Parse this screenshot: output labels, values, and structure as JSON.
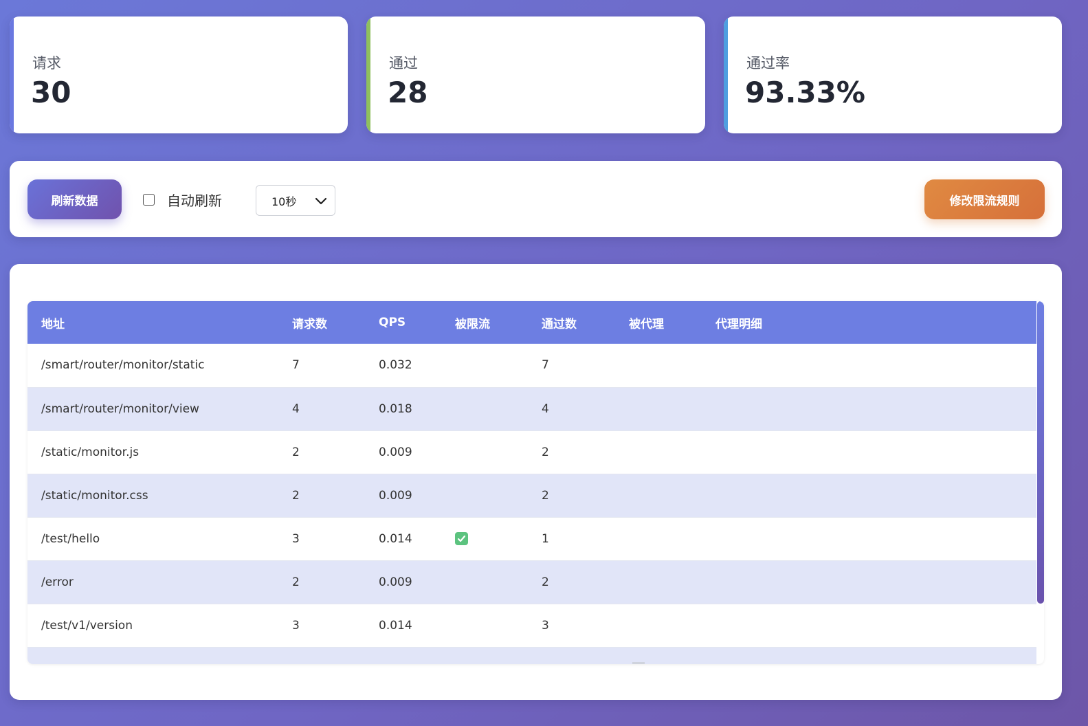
{
  "stats": {
    "requests": {
      "label": "请求",
      "value": "30",
      "accent": "#6a78e0"
    },
    "passed": {
      "label": "通过",
      "value": "28",
      "accent": "#8fbf5e"
    },
    "pass_rate": {
      "label": "通过率",
      "value": "93.33%",
      "accent": "#4f9ee0"
    }
  },
  "controls": {
    "refresh_label": "刷新数据",
    "auto_refresh_label": "自动刷新",
    "auto_refresh_checked": false,
    "interval_value": "10秒",
    "edit_rules_label": "修改限流规则"
  },
  "table": {
    "headers": [
      "地址",
      "请求数",
      "QPS",
      "被限流",
      "通过数",
      "被代理",
      "代理明细"
    ],
    "rows": [
      {
        "path": "/smart/router/monitor/static",
        "requests": "7",
        "qps": "0.032",
        "throttled": false,
        "passed": "7",
        "proxied": "",
        "proxy_detail": ""
      },
      {
        "path": "/smart/router/monitor/view",
        "requests": "4",
        "qps": "0.018",
        "throttled": false,
        "passed": "4",
        "proxied": "",
        "proxy_detail": ""
      },
      {
        "path": "/static/monitor.js",
        "requests": "2",
        "qps": "0.009",
        "throttled": false,
        "passed": "2",
        "proxied": "",
        "proxy_detail": ""
      },
      {
        "path": "/static/monitor.css",
        "requests": "2",
        "qps": "0.009",
        "throttled": false,
        "passed": "2",
        "proxied": "",
        "proxy_detail": ""
      },
      {
        "path": "/test/hello",
        "requests": "3",
        "qps": "0.014",
        "throttled": true,
        "passed": "1",
        "proxied": "",
        "proxy_detail": ""
      },
      {
        "path": "/error",
        "requests": "2",
        "qps": "0.009",
        "throttled": false,
        "passed": "2",
        "proxied": "",
        "proxy_detail": ""
      },
      {
        "path": "/test/v1/version",
        "requests": "3",
        "qps": "0.014",
        "throttled": false,
        "passed": "3",
        "proxied": "",
        "proxy_detail": ""
      },
      {
        "path": "",
        "requests": "",
        "qps": "",
        "throttled": false,
        "passed": "",
        "proxied": "",
        "proxy_detail": ""
      }
    ],
    "throttled_icon": "check-square-icon"
  }
}
